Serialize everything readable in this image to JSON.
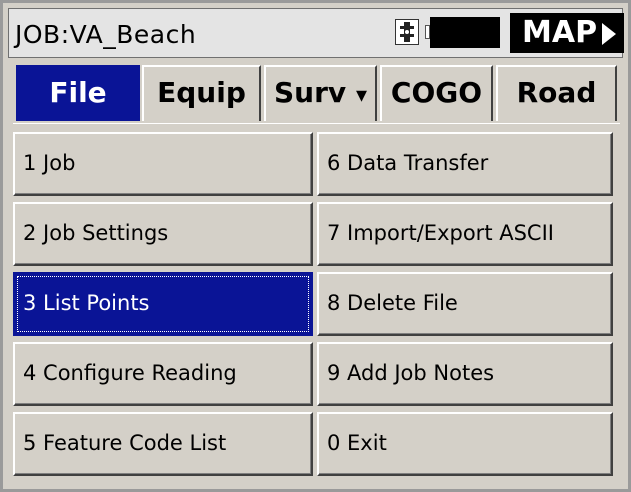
{
  "titlebar": {
    "job_title": "JOB:VA_Beach",
    "map_label": "MAP",
    "icons": {
      "device": "device-icon",
      "battery": "battery-icon",
      "map_arrow": "play-arrow-icon"
    }
  },
  "tabs": [
    {
      "label": "File",
      "active": true
    },
    {
      "label": "Equip",
      "active": false
    },
    {
      "label": "Surv",
      "active": false
    },
    {
      "label": "COGO",
      "active": false
    },
    {
      "label": "Road",
      "active": false
    }
  ],
  "menu": {
    "left": [
      {
        "label": "1 Job"
      },
      {
        "label": "2 Job Settings"
      },
      {
        "label": "3 List Points",
        "selected": true
      },
      {
        "label": "4 Configure Reading"
      },
      {
        "label": "5 Feature Code List"
      }
    ],
    "right": [
      {
        "label": "6 Data Transfer"
      },
      {
        "label": "7 Import/Export ASCII"
      },
      {
        "label": "8 Delete File"
      },
      {
        "label": "9 Add Job Notes"
      },
      {
        "label": "0 Exit"
      }
    ]
  },
  "colors": {
    "accent": "#0a1496",
    "panel": "#d4d0c8",
    "titlebar": "#e4e4e4"
  }
}
